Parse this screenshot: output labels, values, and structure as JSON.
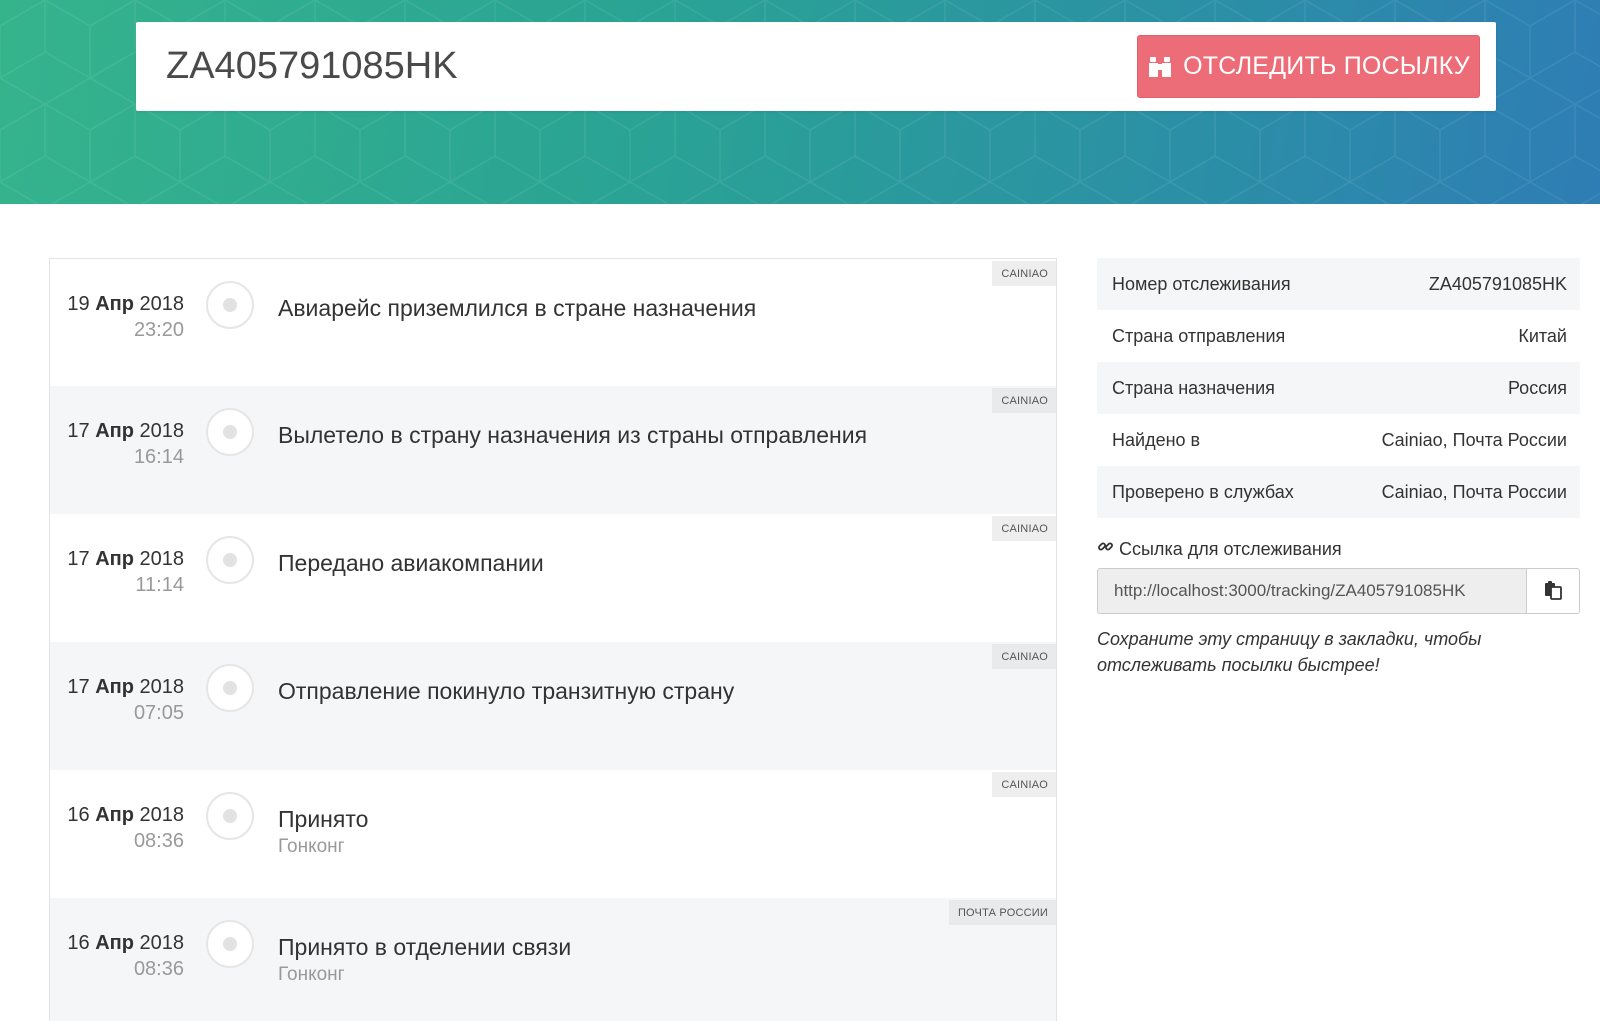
{
  "header": {
    "tracking_input_value": "ZA405791085HK",
    "track_button_label": "ОТСЛЕДИТЬ ПОСЫЛКУ",
    "track_button_icon": "binoculars-icon",
    "accent_color": "#ec6d77"
  },
  "events": [
    {
      "day": "19",
      "month": "Апр",
      "year": "2018",
      "time": "23:20",
      "title": "Авиарейс приземлился в стране назначения",
      "location": "",
      "source": "CAINIAO"
    },
    {
      "day": "17",
      "month": "Апр",
      "year": "2018",
      "time": "16:14",
      "title": "Вылетело в страну назначения из страны отправления",
      "location": "",
      "source": "CAINIAO"
    },
    {
      "day": "17",
      "month": "Апр",
      "year": "2018",
      "time": "11:14",
      "title": "Передано авиакомпании",
      "location": "",
      "source": "CAINIAO"
    },
    {
      "day": "17",
      "month": "Апр",
      "year": "2018",
      "time": "07:05",
      "title": "Отправление покинуло транзитную страну",
      "location": "",
      "source": "CAINIAO"
    },
    {
      "day": "16",
      "month": "Апр",
      "year": "2018",
      "time": "08:36",
      "title": "Принято",
      "location": "Гонконг",
      "source": "CAINIAO"
    },
    {
      "day": "16",
      "month": "Апр",
      "year": "2018",
      "time": "08:36",
      "title": "Принято в отделении связи",
      "location": "Гонконг",
      "source": "ПОЧТА РОССИИ"
    }
  ],
  "info": {
    "rows": [
      {
        "label": "Номер отслеживания",
        "value": "ZA405791085HK"
      },
      {
        "label": "Страна отправления",
        "value": "Китай"
      },
      {
        "label": "Страна назначения",
        "value": "Россия"
      },
      {
        "label": "Найдено в",
        "value": "Cainiao, Почта России"
      },
      {
        "label": "Проверено в службах",
        "value": "Cainiao, Почта России"
      }
    ],
    "link_label": "Ссылка для отслеживания",
    "link_icon": "link-icon",
    "link_value": "http://localhost:3000/tracking/ZA405791085HK",
    "copy_icon": "clipboard-icon",
    "bookmark_hint": "Сохраните эту страницу в закладки, чтобы отслеживать посылки быстрее!"
  }
}
